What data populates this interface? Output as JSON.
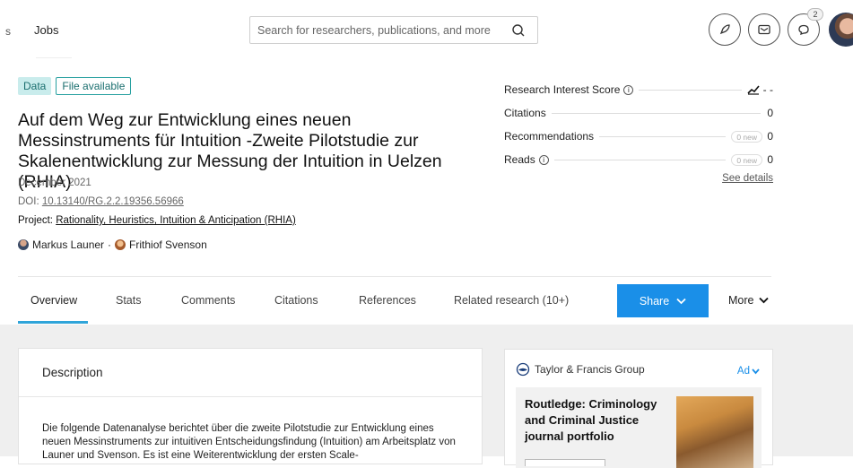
{
  "topbar": {
    "edge_glyph": "s",
    "nav_jobs": "Jobs",
    "search_placeholder": "Search for researchers, publications, and more",
    "notifications_count": "2",
    "icons": [
      "rocket-icon",
      "mail-icon",
      "chat-icon",
      "user-avatar"
    ]
  },
  "tags": {
    "data": "Data",
    "file": "File available"
  },
  "publication": {
    "title": "Auf dem Weg zur Entwicklung eines neuen Messinstruments für Intuition -Zweite Pilotstudie zur Skalenentwicklung zur Messung der Intuition in Uelzen (RHIA)",
    "date": "December 2021",
    "doi_label": "DOI: ",
    "doi_value": "10.13140/RG.2.2.19356.56966",
    "project_label": "Project: ",
    "project_value": "Rationality, Heuristics, Intuition & Anticipation (RHIA)",
    "author1": "Markus Launer",
    "author_sep": "·",
    "author2": "Frithiof Svenson"
  },
  "stats": {
    "ris_label": "Research Interest Score",
    "ris_value": "- -",
    "citations_label": "Citations",
    "citations_value": "0",
    "recommendations_label": "Recommendations",
    "recommendations_new": "0 new",
    "recommendations_value": "0",
    "reads_label": "Reads",
    "reads_new": "0 new",
    "reads_value": "0",
    "see_details": "See details"
  },
  "tabs": {
    "overview": "Overview",
    "stats": "Stats",
    "comments": "Comments",
    "citations": "Citations",
    "references": "References",
    "related": "Related research (10+)",
    "share": "Share",
    "more": "More"
  },
  "description": {
    "heading": "Description",
    "text": "Die folgende Datenanalyse berichtet über die zweite Pilotstudie zur Entwicklung eines neuen Messinstruments zur intuitiven Entscheidungsfindung (Intuition) am Arbeitsplatz von Launer und Svenson. Es ist eine Weiterentwicklung der ersten Scale-"
  },
  "ad": {
    "publisher": "Taylor & Francis Group",
    "ad_label": "Ad",
    "title": "Routledge: Criminology and Criminal Justice journal portfolio"
  },
  "colors": {
    "accent": "#1a8fe8",
    "tab_underline": "#2fa4d9",
    "tag_bg": "#c9ecec",
    "tag_text": "#1b6f6f"
  }
}
